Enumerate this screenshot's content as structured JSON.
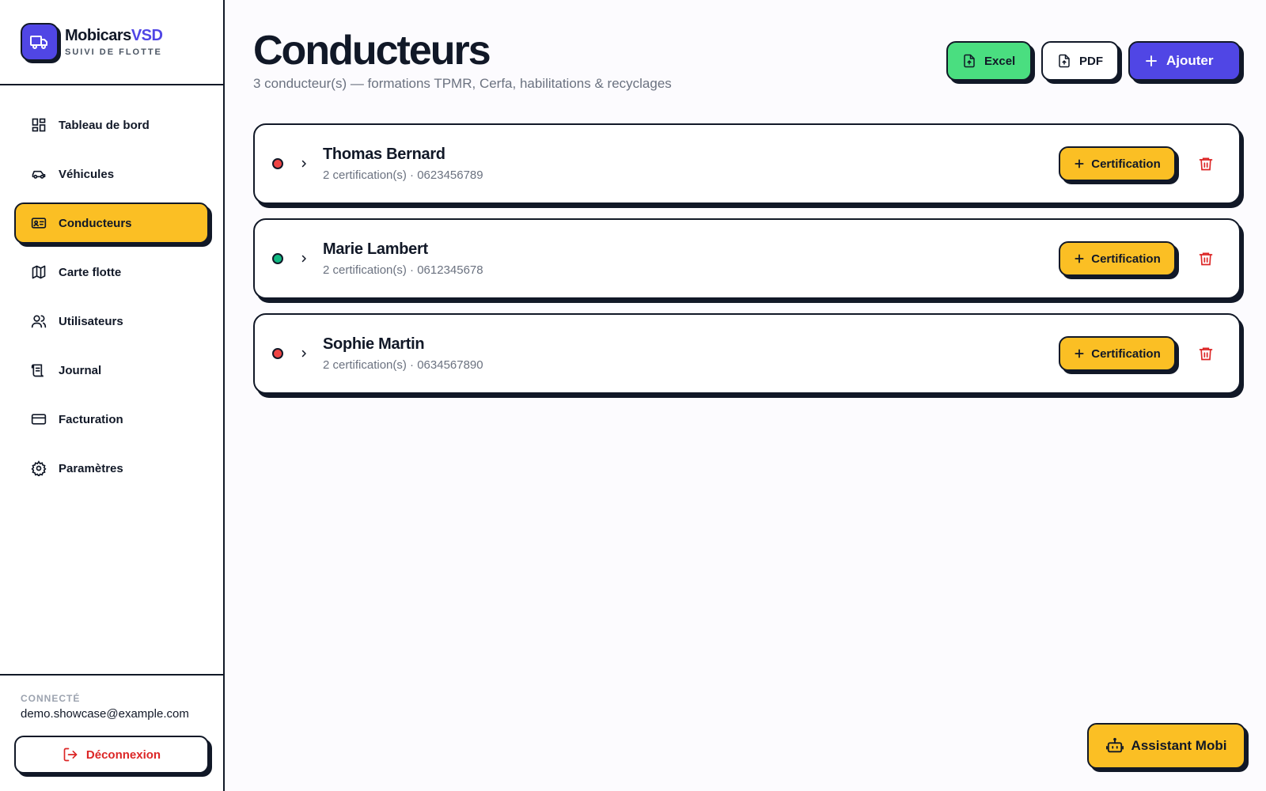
{
  "brand": {
    "name_main": "Mobicars",
    "name_accent": "VSD",
    "tagline": "SUIVI DE FLOTTE",
    "logo_icon": "truck-icon"
  },
  "sidebar": {
    "items": [
      {
        "label": "Tableau de bord",
        "icon": "dashboard-grid-icon",
        "active": false
      },
      {
        "label": "Véhicules",
        "icon": "car-icon",
        "active": false
      },
      {
        "label": "Conducteurs",
        "icon": "id-card-icon",
        "active": true
      },
      {
        "label": "Carte flotte",
        "icon": "map-icon",
        "active": false
      },
      {
        "label": "Utilisateurs",
        "icon": "users-icon",
        "active": false
      },
      {
        "label": "Journal",
        "icon": "scroll-icon",
        "active": false
      },
      {
        "label": "Facturation",
        "icon": "credit-card-icon",
        "active": false
      },
      {
        "label": "Paramètres",
        "icon": "gear-icon",
        "active": false
      }
    ],
    "footer": {
      "connected_label": "CONNECTÉ",
      "email": "demo.showcase@example.com",
      "logout_label": "Déconnexion"
    }
  },
  "header": {
    "title": "Conducteurs",
    "subtitle": "3 conducteur(s) — formations TPMR, Cerfa, habilitations & recyclages",
    "excel_label": "Excel",
    "pdf_label": "PDF",
    "add_label": "Ajouter"
  },
  "drivers": [
    {
      "name": "Thomas Bernard",
      "meta": "2 certification(s) · 0623456789",
      "status_color": "#ef4444",
      "cert_label": "Certification"
    },
    {
      "name": "Marie Lambert",
      "meta": "2 certification(s) · 0612345678",
      "status_color": "#10b981",
      "cert_label": "Certification"
    },
    {
      "name": "Sophie Martin",
      "meta": "2 certification(s) · 0634567890",
      "status_color": "#ef4444",
      "cert_label": "Certification"
    }
  ],
  "assistant": {
    "label": "Assistant Mobi"
  },
  "colors": {
    "accent": "#5046e5",
    "highlight": "#fbbf24",
    "excel": "#4ade80",
    "danger": "#dc2626"
  }
}
